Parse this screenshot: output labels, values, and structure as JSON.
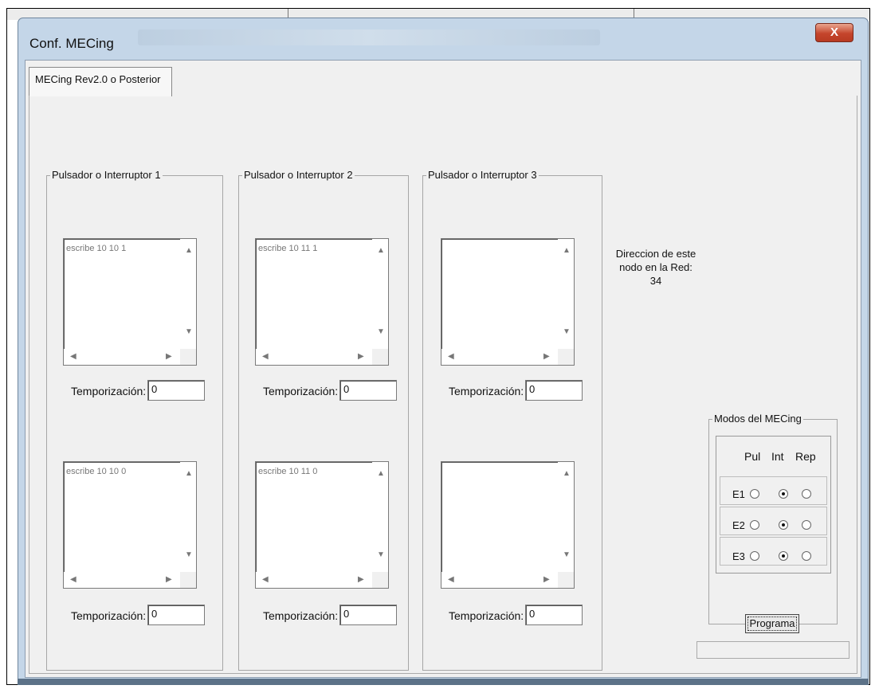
{
  "window": {
    "title": "Conf. MECing",
    "close_label": "X"
  },
  "tab": {
    "label": "MECing Rev2.0 o Posterior"
  },
  "groups": [
    {
      "legend": "Pulsador o Interruptor 1",
      "top_text": "escribe 10 10 1",
      "bottom_text": "escribe 10 10 0",
      "timer_label": "Temporización:",
      "timer_top": "0",
      "timer_bottom": "0"
    },
    {
      "legend": "Pulsador o Interruptor 2",
      "top_text": "escribe 10 11 1",
      "bottom_text": "escribe 10 11 0",
      "timer_label": "Temporización:",
      "timer_top": "0",
      "timer_bottom": "0"
    },
    {
      "legend": "Pulsador o Interruptor 3",
      "top_text": "",
      "bottom_text": "",
      "timer_label": "Temporización:",
      "timer_top": "0",
      "timer_bottom": "0"
    }
  ],
  "node": {
    "line1": "Direccion de este",
    "line2": "nodo en la Red:",
    "value": "34"
  },
  "modes": {
    "legend": "Modos del MECing",
    "headers": [
      "Pul",
      "Int",
      "Rep"
    ],
    "rows": [
      {
        "label": "E1",
        "selected": "Int"
      },
      {
        "label": "E2",
        "selected": "Int"
      },
      {
        "label": "E3",
        "selected": "Int"
      }
    ]
  },
  "program_button": "Programa"
}
